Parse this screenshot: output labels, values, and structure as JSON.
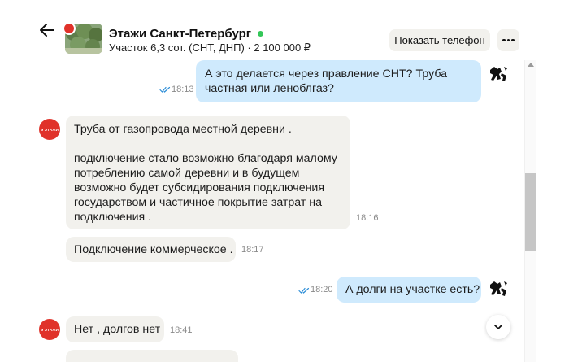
{
  "header": {
    "title": "Этажи Санкт-Петербург",
    "subtitle": "Участок 6,3 сот. (СНТ, ДНП) · 2 100 000 ₽",
    "show_phone_label": "Показать телефон",
    "online_color": "#34c759"
  },
  "avatar": {
    "seller_label": "Э ЭТАЖИ",
    "seller_color": "#e0322a"
  },
  "messages": [
    {
      "direction": "out",
      "text": "А это делается через правление СНТ? Труба\nчастная или леноблгаз?",
      "time": "18:13",
      "read": true
    },
    {
      "direction": "in",
      "text": "Труба от газопровода местной деревни .\n\nподключение стало возможно благодаря малому\nпотреблению самой деревни и в будущем\nвозможно будет субсидирования подключения\nгосударством и частичное покрытие затрат на\nподключения .",
      "time": "18:16"
    },
    {
      "direction": "in",
      "text": "Подключение коммерческое .",
      "time": "18:17"
    },
    {
      "direction": "out",
      "text": "А долги на участке есть?",
      "time": "18:20",
      "read": true
    },
    {
      "direction": "in",
      "text": "Нет , долгов нет",
      "time": "18:41"
    }
  ],
  "colors": {
    "incoming_bubble": "#f2f1ed",
    "outgoing_bubble": "#cfeafd",
    "read_ticks": "#2f8fd8"
  }
}
